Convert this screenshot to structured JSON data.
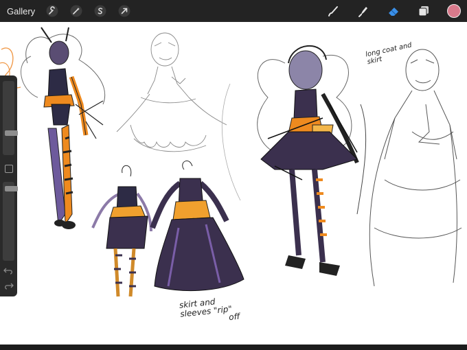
{
  "toolbar": {
    "gallery_label": "Gallery",
    "left_icons": [
      "wrench-icon",
      "magic-wand-icon",
      "selection-s-icon",
      "transform-arrow-icon"
    ],
    "right_icons": [
      "brush-icon",
      "smudge-icon",
      "eraser-icon",
      "layers-icon"
    ],
    "current_color": "#d97a8c",
    "accent_color": "#3a8fe8"
  },
  "sidebar": {
    "brush_size": 0.25,
    "opacity": 0.95
  },
  "canvas": {
    "notes": {
      "long_coat_and_skirt": "long coat and skirt",
      "skirt_sleeves_line1": "skirt and",
      "skirt_sleeves_line2": "sleeves \"rip\"",
      "skirt_sleeves_line3": "off"
    }
  }
}
